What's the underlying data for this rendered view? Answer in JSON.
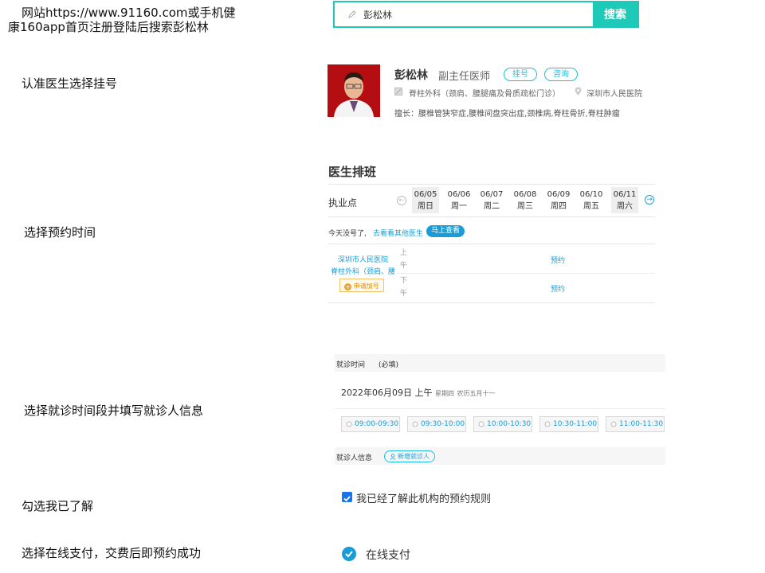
{
  "steps": {
    "step1_line1": "网站https://www.91160.com或手机健",
    "step1_line2": "康160app首页注册登陆后搜索彭松林",
    "step2": "认准医生选择挂号",
    "step3": "选择预约时间",
    "step4": "选择就诊时间段并填写就诊人信息",
    "step5": "勾选我已了解",
    "step6": "选择在线支付，交费后即预约成功"
  },
  "search": {
    "value": "彭松林",
    "button": "搜索",
    "icon": "pencil-icon"
  },
  "doctor": {
    "name": "彭松林",
    "title": "副主任医师",
    "btn_register": "挂号",
    "btn_consult": "咨询",
    "department": "脊柱外科（颈肩、腰腿痛及骨质疏松门诊）",
    "hospital": "深圳市人民医院",
    "specialty": "擅长：腰椎管狭窄症,腰椎间盘突出症,颈椎病,脊柱骨折,脊柱肿瘤"
  },
  "schedule": {
    "title": "医生排班",
    "label": "执业点",
    "days": [
      {
        "date": "06/05",
        "week": "周日",
        "highlight": true
      },
      {
        "date": "06/06",
        "week": "周一",
        "highlight": false
      },
      {
        "date": "06/07",
        "week": "周二",
        "highlight": false
      },
      {
        "date": "06/08",
        "week": "周三",
        "highlight": false
      },
      {
        "date": "06/09",
        "week": "周四",
        "highlight": false
      },
      {
        "date": "06/10",
        "week": "周五",
        "highlight": false
      },
      {
        "date": "06/11",
        "week": "周六",
        "highlight": true
      }
    ],
    "no_source": "今天没号了,",
    "other_link": "去看看其他医生",
    "check_now": "马上查看",
    "hospital": "深圳市人民医院",
    "department": "脊柱外科（颈肩、腰",
    "add_number": "申请加号",
    "am_1": "上",
    "am_2": "午",
    "pm_1": "下",
    "pm_2": "午",
    "book_am": "预约",
    "book_pm": "预约"
  },
  "appointment": {
    "time_label": "就诊时间",
    "required": "(必填)",
    "date": "2022年06月09日 上午",
    "weekday": "星期四",
    "lunar": "农历五月十一",
    "slots": [
      "09:00-09:30",
      "09:30-10:00",
      "10:00-10:30",
      "10:30-11:00",
      "11:00-11:30"
    ],
    "patient_label": "就诊人信息",
    "add_patient": "新增就诊人"
  },
  "agree": {
    "text": "我已经了解此机构的预约规则",
    "checked": true
  },
  "payment": {
    "text": "在线支付",
    "selected": true
  },
  "colors": {
    "teal": "#1dc9b7",
    "blue": "#1a9cd6",
    "checkbox": "#1a73e8"
  }
}
